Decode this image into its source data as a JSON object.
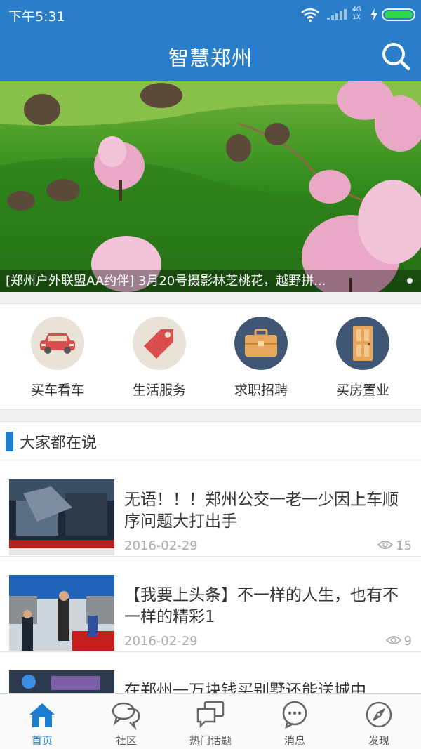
{
  "status_bar": {
    "time": "下午5:31",
    "network": [
      "4G",
      "1X"
    ]
  },
  "header": {
    "title": "智慧郑州",
    "search_icon": "search-icon"
  },
  "banner": {
    "caption": "[郑州户外联盟AA约伴] 3月20号摄影林芝桃花，越野拼..."
  },
  "services": [
    {
      "label": "买车看车",
      "icon": "car-icon",
      "color": "#e9e5dc"
    },
    {
      "label": "生活服务",
      "icon": "tag-icon",
      "color": "#e9e5dc"
    },
    {
      "label": "求职招聘",
      "icon": "briefcase-icon",
      "color": "#3f5674"
    },
    {
      "label": "买房置业",
      "icon": "door-icon",
      "color": "#3f5674"
    }
  ],
  "section": {
    "title": "大家都在说"
  },
  "news": [
    {
      "title": "无语！！！郑州公交一老一少因上车顺序问题大打出手",
      "date": "2016-02-29",
      "views": "15"
    },
    {
      "title": "【我要上头条】不一样的人生，也有不一样的精彩1",
      "date": "2016-02-29",
      "views": "9"
    },
    {
      "title": "在郑州一万块钱买别墅还能送城中",
      "date": "",
      "views": ""
    }
  ],
  "tabs": [
    {
      "label": "首页",
      "icon": "home-icon",
      "active": true
    },
    {
      "label": "社区",
      "icon": "chat-bubbles-icon",
      "active": false
    },
    {
      "label": "热门话题",
      "icon": "topics-icon",
      "active": false
    },
    {
      "label": "消息",
      "icon": "message-icon",
      "active": false
    },
    {
      "label": "发现",
      "icon": "compass-icon",
      "active": false
    }
  ]
}
